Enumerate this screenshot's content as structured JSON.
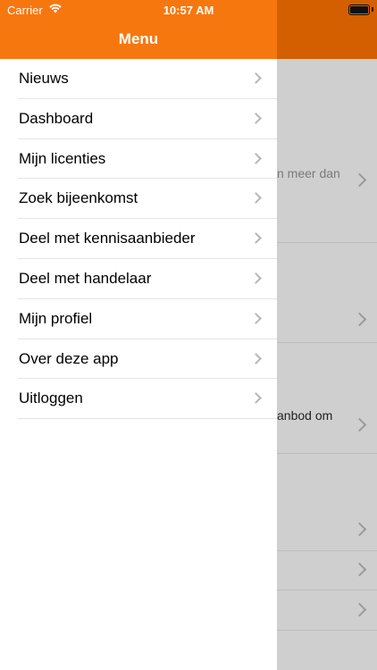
{
  "status_bar": {
    "carrier": "Carrier",
    "time": "10:57 AM",
    "wifi_icon": "wifi-icon",
    "battery_icon": "battery-icon"
  },
  "drawer": {
    "title": "Menu",
    "header_color": "#f7770f",
    "items": [
      {
        "label": "Nieuws"
      },
      {
        "label": "Dashboard"
      },
      {
        "label": "Mijn licenties"
      },
      {
        "label": "Zoek bijeenkomst"
      },
      {
        "label": "Deel met kennisaanbieder"
      },
      {
        "label": "Deel met handelaar"
      },
      {
        "label": "Mijn profiel"
      },
      {
        "label": "Over deze app"
      },
      {
        "label": "Uitloggen"
      }
    ]
  },
  "background": {
    "text_1": "n meer dan",
    "text_2": "anbod om"
  }
}
